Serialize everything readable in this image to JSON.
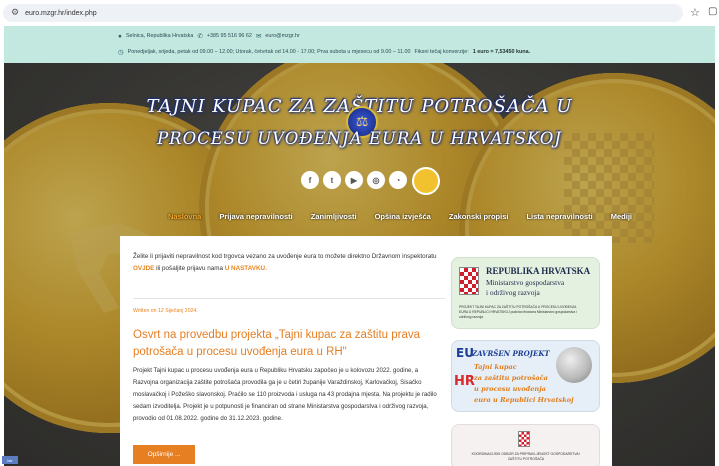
{
  "browser": {
    "url": "euro.mzgr.hr/index.php",
    "tune_icon": "tune-icon",
    "star_icon": "star-icon",
    "extension_icon": "extension-icon"
  },
  "infobar": {
    "location": "Selnica, Republika Hrvatska",
    "phone": "+385 95 516 96 62",
    "email": "euro@mzgr.hr",
    "hours": "Ponedjeljak, srijeda, petak od 09.00 – 12.00; Utorak, četvrtak od 14.00 - 17.00; Prva subota u mjesecu od 9.00 – 11.00",
    "conversion_label": "Fiksni tečaj konverzije:",
    "conversion_value": "1 euro = 7,53450 kuna."
  },
  "hero": {
    "title_line1": "TAJNI KUPAC ZA ZAŠTITU POTROŠAČA U",
    "title_line2": "PROCESU UVOĐENJA EURA U HRVATSKOJ",
    "socials": [
      "f",
      "t",
      "▶",
      "◎",
      "◔"
    ]
  },
  "nav": {
    "items": [
      "Naslovna",
      "Prijava nepravilnosti",
      "Zanimljivosti",
      "Opšina izvješća",
      "Zakonski propisi",
      "Lista nepravilnosti",
      "Mediji"
    ],
    "active_index": 0
  },
  "content": {
    "intro_part1": "Želite li prijaviti nepravilnost kod trgovca vezano za uvođenje eura to možete direktno Državnom inspektoratu ",
    "intro_link1": "OVJDE",
    "intro_part2": " ili pošaljite prijavu nama ",
    "intro_link2": "U NASTAVKU.",
    "written": "Written on 12 Siječanj 2024.",
    "post_title": "Osvrt na provedbu projekta „Tajni kupac za zaštitu prava potrošača u procesu uvođenja eura u RH\"",
    "post_body": "Projekt Tajni kupac u procesu uvođenja eura u Republiku Hrvatsku započeo je u kolovozu 2022. godine, a Razvojna organizacija zaštite potrošača provodila ga je u četiri županije Varaždinskoj, Karlovačkoj, Sisačko moslavačkoj i Požeško slavonskoj. Praćilo se 110 proizvoda i usluga na 43 prodajna mjesta. Na projektu je radilo sedam izvoditelja. Projekt je u potpunosti je financiran od strane Ministarstva gospodarstva i održivog razvoja, provodio od 01.08.2022. godine do 31.12.2023. godine.",
    "read_more": "Opširnije ..."
  },
  "sidebar": {
    "card1_title": "REPUBLIKA HRVATSKA",
    "card1_sub1": "Ministarstvo gospodarstva",
    "card1_sub2": "i održivog razvoja",
    "card1_small": "PROJEKT TAJNI KUPAC ZA ZAŠTITU POTROŠAČA U PROCESU UVOĐENJA EURA U REPUBLICI HRVATSKOJ podržan financira Ministarstvo gospodarstva i održivog razvoja",
    "card2_eu": "EU",
    "card2_hr": "HR",
    "card2_banner": "ZAVRŠEN PROJEKT",
    "card2_lines": [
      "Tajni kupac",
      "za zaštitu potrošača",
      "u procesu uvođenja",
      "eura u Republici Hrvatskoj"
    ],
    "card3_text": "KOORDINACIJSKI ODBOR ZA PRIPRAVLJENOST GOSPODARSTVA I ZAŠTITU POTROŠAČA"
  },
  "corner_badge": "lstr"
}
